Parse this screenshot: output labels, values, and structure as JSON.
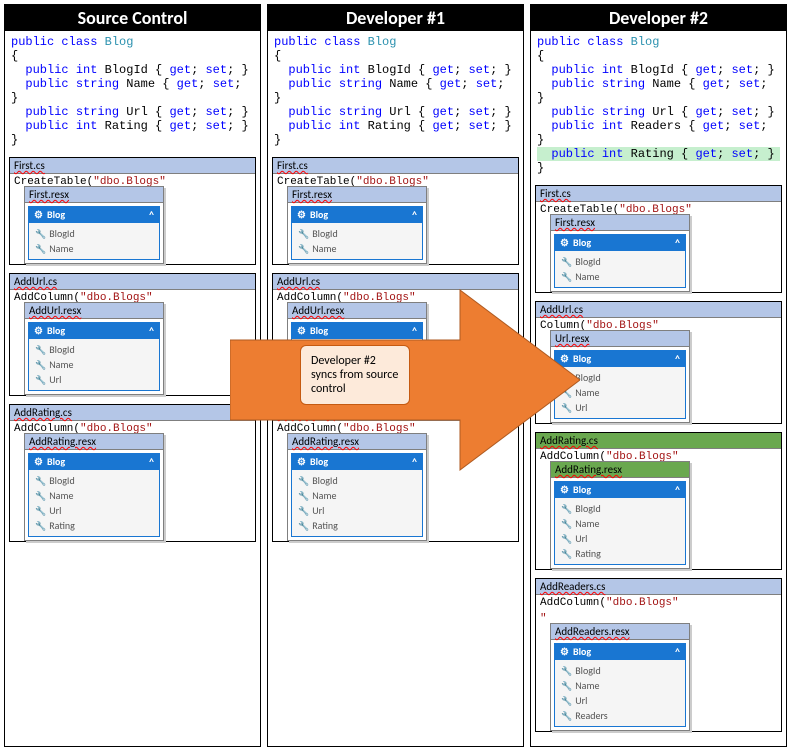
{
  "headers": {
    "c0": "Source Control",
    "c1": "Developer #1",
    "c2": "Developer #2"
  },
  "code": {
    "l1a": "public",
    "l1b": "class",
    "l1c": "Blog",
    "p1a": "public",
    "p1b": "int",
    "p1c": "BlogId { ",
    "p1d": "get",
    "p1e": "; ",
    "p1f": "set",
    "p1g": "; }",
    "p2c": "Name { ",
    "p3c": "Url { ",
    "p4c": "Rating { ",
    "p5c": "Readers { ",
    "string": "string"
  },
  "files": {
    "first": "First.cs",
    "firstr": "First.resx",
    "addurl": "AddUrl.cs",
    "addurlr": "AddUrl.resx",
    "urlr": "Url.resx",
    "addrating": "AddRating.cs",
    "addratingr": "AddRating.resx",
    "addreaders": "AddReaders.cs",
    "addreadersr": "AddReaders.resx",
    "ct": "CreateTable(",
    "ac": "AddColumn(",
    "dbo": "\"dbo.Blogs\"",
    "column": "Column(",
    "q": "\""
  },
  "dgm": {
    "blog": "Blog",
    "blogid": "BlogId",
    "name": "Name",
    "url": "Url",
    "rating": "Rating",
    "readers": "Readers",
    "chev": "^"
  },
  "callout": "Developer #2 syncs from source control"
}
